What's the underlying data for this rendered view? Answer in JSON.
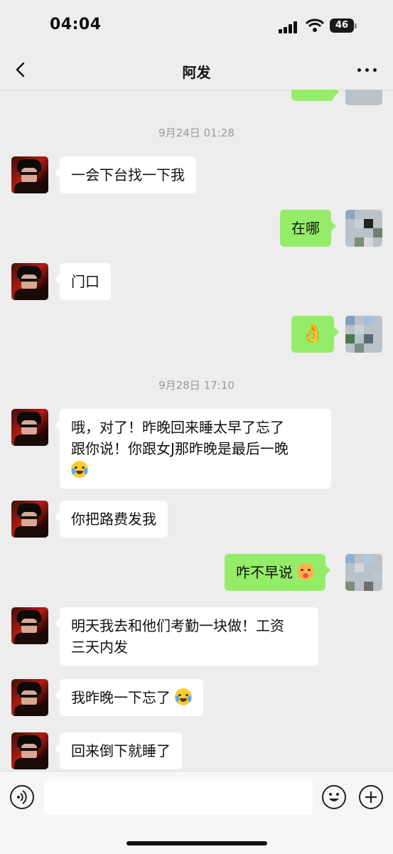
{
  "status_bar": {
    "time": "04:04",
    "battery": "46"
  },
  "nav": {
    "title": "阿发",
    "more_icon": "more-dots-icon",
    "back_icon": "chevron-left-icon"
  },
  "chat": {
    "timestamps": [
      "9月24日 01:28",
      "9月28日 17:10"
    ],
    "messages": [
      {
        "from": "them",
        "text": "一会下台找一下我"
      },
      {
        "from": "me",
        "text": "在哪"
      },
      {
        "from": "them",
        "text": "门口"
      },
      {
        "from": "me",
        "emoji": "ok-hand"
      },
      {
        "from": "them",
        "line1": "哦，对了！昨晚回来睡太早了忘了",
        "line2": "跟你说！你跟女J那昨晚是最后一晚",
        "emoji": "laugh-cry"
      },
      {
        "from": "them",
        "text": "你把路费发我"
      },
      {
        "from": "me",
        "text": "咋不早说",
        "emoji": "surprised-face"
      },
      {
        "from": "them",
        "line1": "明天我去和他们考勤一块做！工资",
        "line2": "三天内发"
      },
      {
        "from": "them",
        "text": "我昨晚一下忘了",
        "emoji": "laugh-cry"
      },
      {
        "from": "them",
        "text": "回来倒下就睡了"
      }
    ]
  },
  "input_bar": {
    "voice_icon": "voice-icon",
    "emoji_icon": "emoji-icon",
    "plus_icon": "plus-icon",
    "placeholder": ""
  },
  "colors": {
    "background": "#ededed",
    "my_bubble": "#95ec69",
    "their_bubble": "#ffffff"
  }
}
